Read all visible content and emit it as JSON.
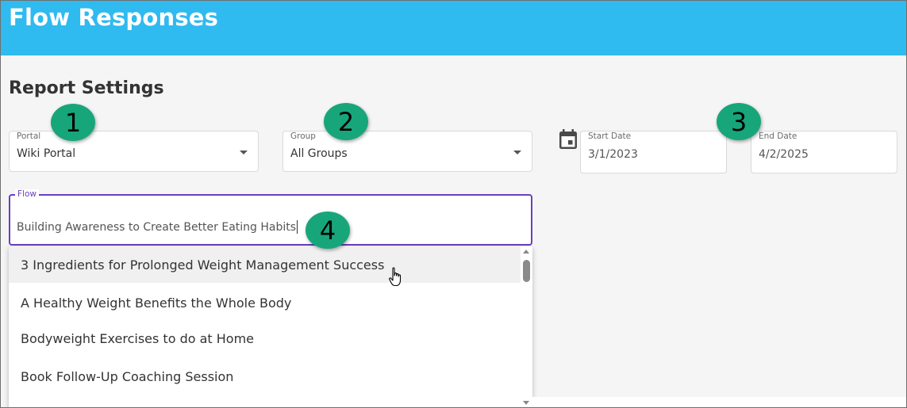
{
  "header": {
    "title": "Flow Responses"
  },
  "report_settings": {
    "title": "Report Settings",
    "portal": {
      "label": "Portal",
      "value": "Wiki Portal"
    },
    "group": {
      "label": "Group",
      "value": "All Groups"
    },
    "start_date": {
      "label": "Start Date",
      "value": "3/1/2023"
    },
    "end_date": {
      "label": "End Date",
      "value": "4/2/2025"
    },
    "flow": {
      "label": "Flow",
      "value": "Building Awareness to Create Better Eating Habits"
    }
  },
  "flow_dropdown": {
    "options": [
      "3 Ingredients for Prolonged Weight Management Success",
      "A Healthy Weight Benefits the Whole Body",
      "Bodyweight Exercises to do at Home",
      "Book Follow-Up Coaching Session"
    ]
  },
  "callouts": [
    "1",
    "2",
    "3",
    "4"
  ],
  "icons": {
    "calendar": "calendar-icon",
    "dropdown_caret": "caret-down-icon",
    "cursor": "hand-pointer-icon"
  },
  "colors": {
    "header": "#2fbaf0",
    "callout": "#17a67a",
    "focus": "#6a3fc2"
  }
}
